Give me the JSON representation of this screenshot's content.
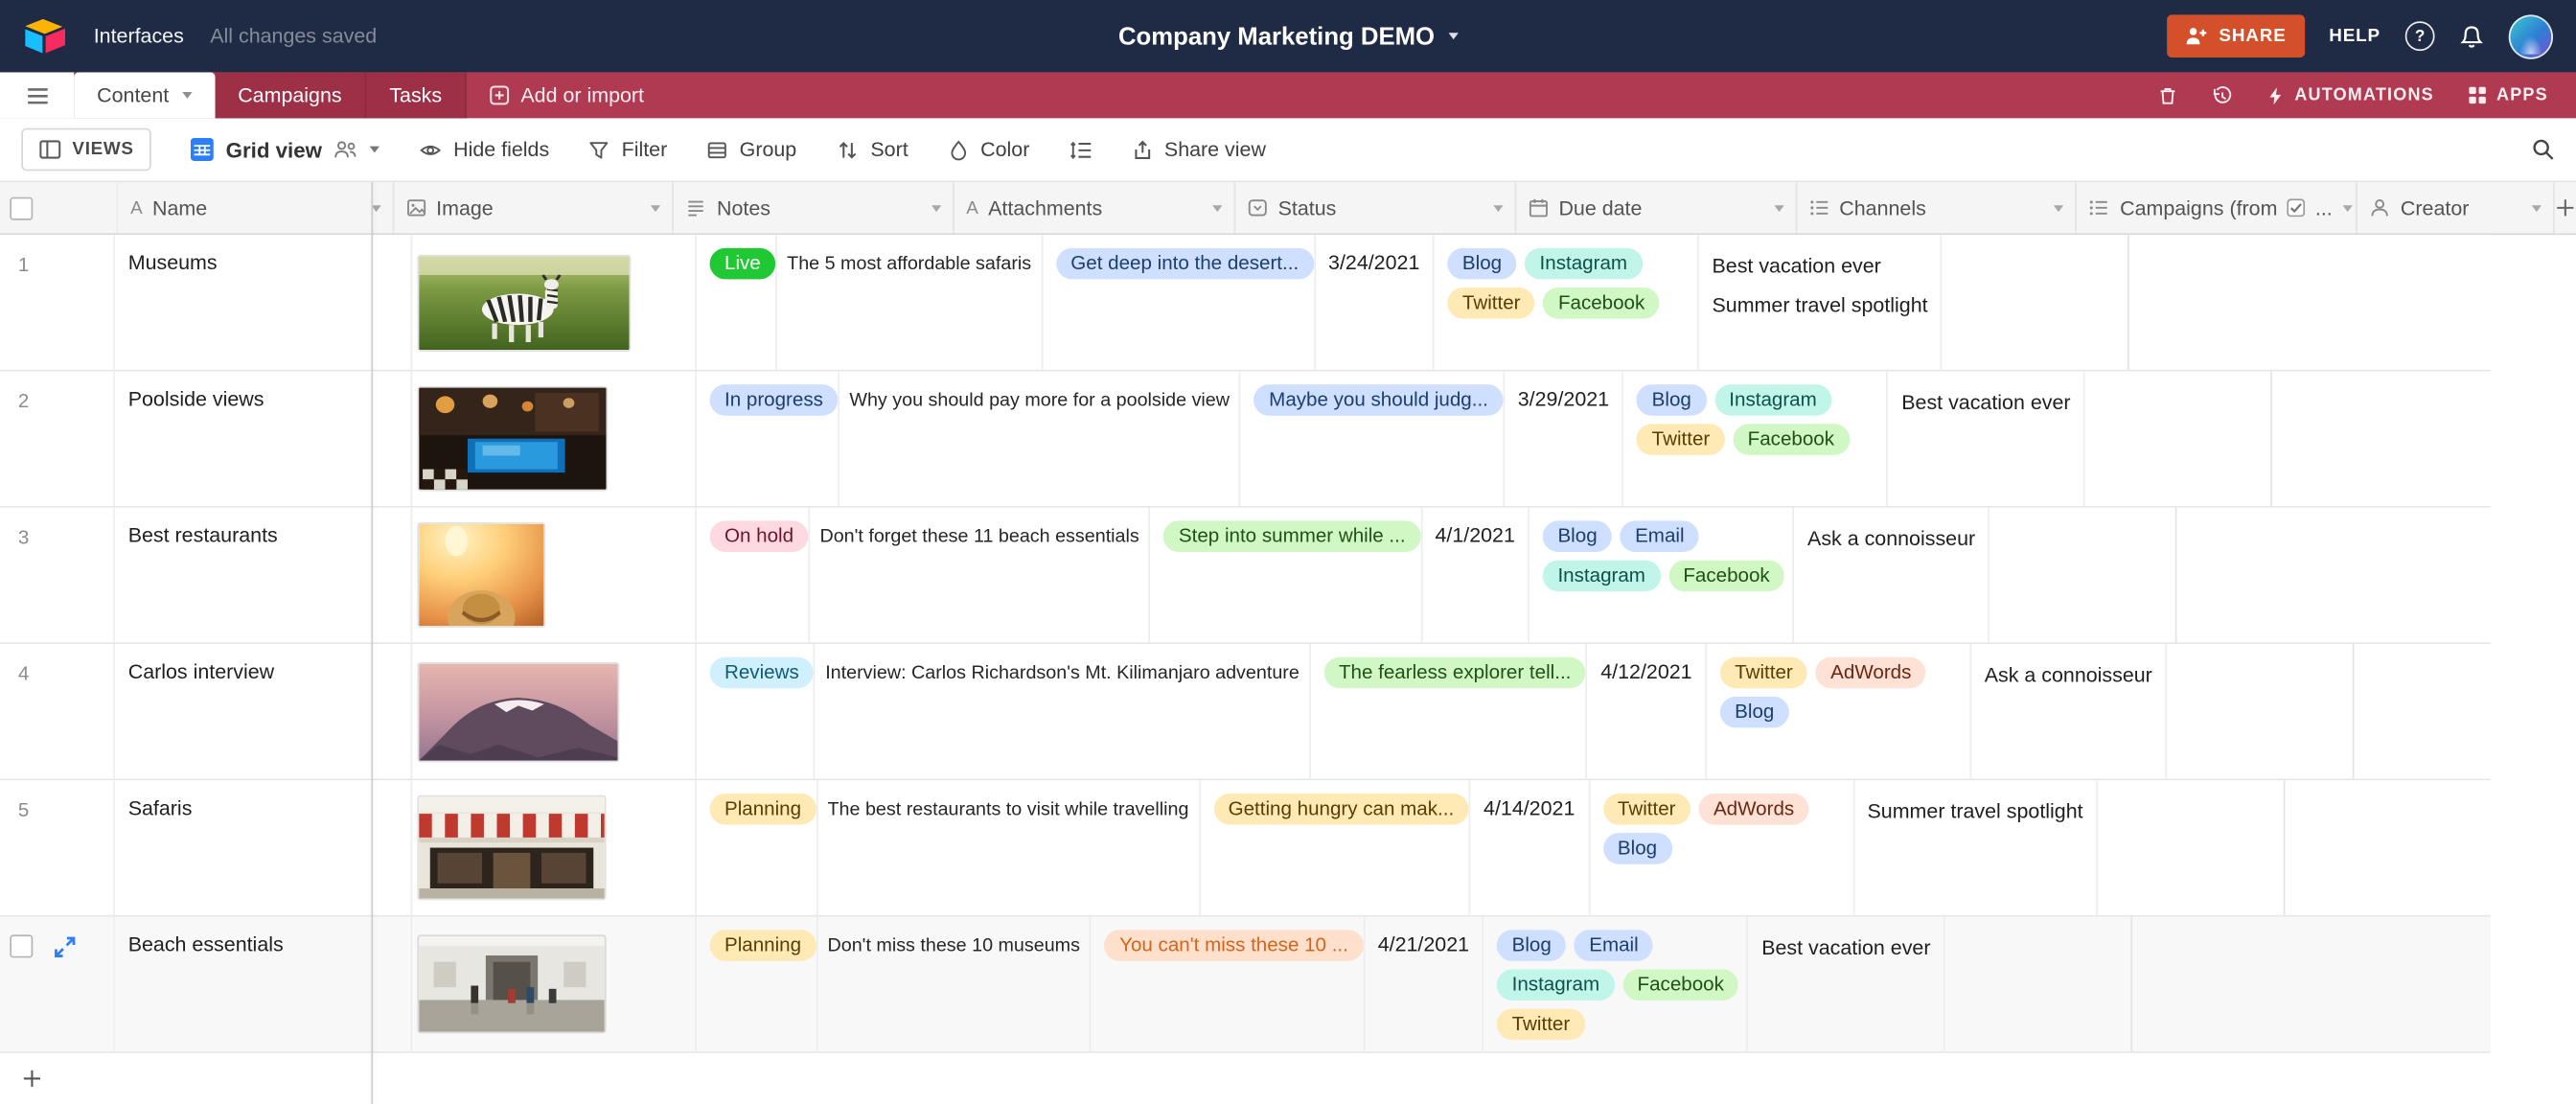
{
  "topbar": {
    "interfaces_label": "Interfaces",
    "save_status": "All changes saved",
    "title": "Company Marketing DEMO",
    "share_label": "SHARE",
    "help_label": "HELP"
  },
  "tabbar": {
    "tabs": [
      {
        "label": "Content",
        "active": true
      },
      {
        "label": "Campaigns",
        "active": false
      },
      {
        "label": "Tasks",
        "active": false
      }
    ],
    "add_label": "Add or import",
    "automations_label": "AUTOMATIONS",
    "apps_label": "APPS"
  },
  "toolbar": {
    "views_label": "VIEWS",
    "view_name": "Grid view",
    "hide_fields_label": "Hide fields",
    "filter_label": "Filter",
    "group_label": "Group",
    "sort_label": "Sort",
    "color_label": "Color",
    "share_view_label": "Share view"
  },
  "grid": {
    "columns": [
      {
        "label": "Name"
      },
      {
        "label": "Image"
      },
      {
        "label": "Notes"
      },
      {
        "label": "Attachments"
      },
      {
        "label": "Status"
      },
      {
        "label": "Due date"
      },
      {
        "label": "Channels"
      },
      {
        "label": "Campaigns (from",
        "suffix": "..."
      },
      {
        "label": "Creator"
      }
    ],
    "rows": [
      {
        "num": "1",
        "name": "Museums",
        "image": "zebra-grassland",
        "note": {
          "label": "Live",
          "color": "solid-green"
        },
        "attachment": "The 5 most affordable safaris",
        "status": {
          "label": "Get deep into the desert...",
          "color": "blue"
        },
        "due": "3/24/2021",
        "channels": [
          {
            "label": "Blog",
            "color": "blue"
          },
          {
            "label": "Instagram",
            "color": "teal"
          },
          {
            "label": "Twitter",
            "color": "yellow"
          },
          {
            "label": "Facebook",
            "color": "green"
          }
        ],
        "campaigns": [
          "Best vacation ever",
          "Summer travel spotlight"
        ]
      },
      {
        "num": "2",
        "name": "Poolside views",
        "image": "poolside-night",
        "note": {
          "label": "In progress",
          "color": "blue"
        },
        "attachment": "Why you should pay more for a poolside view",
        "status": {
          "label": "Maybe you should judg...",
          "color": "blue"
        },
        "due": "3/29/2021",
        "channels": [
          {
            "label": "Blog",
            "color": "blue"
          },
          {
            "label": "Instagram",
            "color": "teal"
          },
          {
            "label": "Twitter",
            "color": "yellow"
          },
          {
            "label": "Facebook",
            "color": "green"
          }
        ],
        "campaigns": [
          "Best vacation ever"
        ]
      },
      {
        "num": "3",
        "name": "Best restaurants",
        "image": "sunset-hat",
        "note": {
          "label": "On hold",
          "color": "red"
        },
        "attachment": "Don't forget these 11 beach essentials",
        "status": {
          "label": "Step into summer while ...",
          "color": "green"
        },
        "due": "4/1/2021",
        "channels": [
          {
            "label": "Blog",
            "color": "blue"
          },
          {
            "label": "Email",
            "color": "blue"
          },
          {
            "label": "Instagram",
            "color": "teal"
          },
          {
            "label": "Facebook",
            "color": "green"
          }
        ],
        "campaigns": [
          "Ask a connoisseur"
        ]
      },
      {
        "num": "4",
        "name": "Carlos interview",
        "image": "mountain-dusk",
        "note": {
          "label": "Reviews",
          "color": "cyan"
        },
        "attachment": "Interview: Carlos Richardson's Mt. Kilimanjaro adventure",
        "status": {
          "label": "The fearless explorer tell...",
          "color": "green"
        },
        "due": "4/12/2021",
        "channels": [
          {
            "label": "Twitter",
            "color": "yellow"
          },
          {
            "label": "AdWords",
            "color": "orange"
          },
          {
            "label": "Blog",
            "color": "blue"
          }
        ],
        "campaigns": [
          "Ask a connoisseur"
        ]
      },
      {
        "num": "5",
        "name": "Safaris",
        "image": "storefront",
        "note": {
          "label": "Planning",
          "color": "yellow"
        },
        "attachment": "The best restaurants to visit while travelling",
        "status": {
          "label": "Getting hungry can mak...",
          "color": "yellow"
        },
        "due": "4/14/2021",
        "channels": [
          {
            "label": "Twitter",
            "color": "yellow"
          },
          {
            "label": "AdWords",
            "color": "orange"
          },
          {
            "label": "Blog",
            "color": "blue"
          }
        ],
        "campaigns": [
          "Summer travel spotlight"
        ]
      },
      {
        "num": "",
        "selected": true,
        "name": "Beach essentials",
        "image": "museum-interior",
        "note": {
          "label": "Planning",
          "color": "yellow"
        },
        "attachment": "Don't miss these 10 museums",
        "status": {
          "label": "You can't miss these 10 ...",
          "color": "orange-text"
        },
        "due": "4/21/2021",
        "channels": [
          {
            "label": "Blog",
            "color": "blue"
          },
          {
            "label": "Email",
            "color": "blue"
          },
          {
            "label": "Instagram",
            "color": "teal"
          },
          {
            "label": "Facebook",
            "color": "green"
          },
          {
            "label": "Twitter",
            "color": "yellow"
          }
        ],
        "campaigns": [
          "Best vacation ever"
        ]
      }
    ]
  },
  "colors": {
    "topbar_bg": "#1f2a44",
    "tabbar_bg": "#b03a52",
    "tab_inactive_bg": "#9d3047",
    "share_button_bg": "#d4502a",
    "grid_view_icon": "#2d7ff9",
    "expand_icon": "#2d7ff9",
    "pill": {
      "blue": {
        "bg": "#cfdfff",
        "fg": "#1c3d6e"
      },
      "teal": {
        "bg": "#c2f5e9",
        "fg": "#0c5148"
      },
      "yellow": {
        "bg": "#ffeab6",
        "fg": "#5a3c00"
      },
      "green": {
        "bg": "#d1f7c4",
        "fg": "#1e5212"
      },
      "orange": {
        "bg": "#fee2d5",
        "fg": "#6b2613"
      },
      "red": {
        "bg": "#ffd9e1",
        "fg": "#6b1430"
      },
      "cyan": {
        "bg": "#d0f0fd",
        "fg": "#0f5a75"
      },
      "solid-green": {
        "bg": "#20c933",
        "fg": "#ffffff"
      },
      "orange-text": {
        "bg": "#ffe0cc",
        "fg": "#d4641c"
      }
    }
  }
}
